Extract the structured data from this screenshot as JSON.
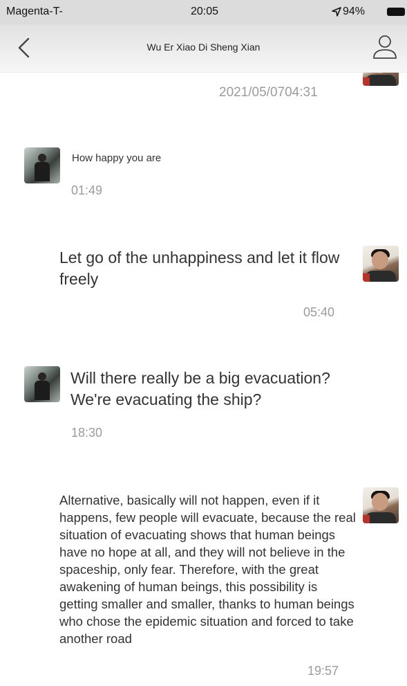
{
  "status_bar": {
    "carrier": "Magenta-T-",
    "time": "20:05",
    "battery": "94%"
  },
  "header": {
    "title": "Wu Er Xiao Di Sheng Xian"
  },
  "messages": [
    {
      "sender": "other",
      "text": "How happy you are",
      "time": "01:49"
    },
    {
      "sender": "self",
      "text": "Let go of the unhappiness and let it flow freely",
      "time": "05:40"
    },
    {
      "sender": "other",
      "text": "Will there really be a big evacuation? We're evacuating the ship?",
      "time": "18:30"
    },
    {
      "sender": "self",
      "text": "Alternative, basically will not happen, even if it happens, few people will evacuate, because the real situation of evacuating shows that human beings have no hope at all, and they will not believe in the spaceship, only fear. Therefore, with the great awakening of human beings, this possibility is getting smaller and smaller, thanks to human beings who chose the epidemic situation and forced to take another road",
      "time": "19:57"
    }
  ],
  "top_timestamp": "2021/05/0704:31",
  "icons": {
    "location": "location-arrow-icon",
    "battery": "battery-icon",
    "back": "chevron-left-icon",
    "profile": "person-icon"
  }
}
